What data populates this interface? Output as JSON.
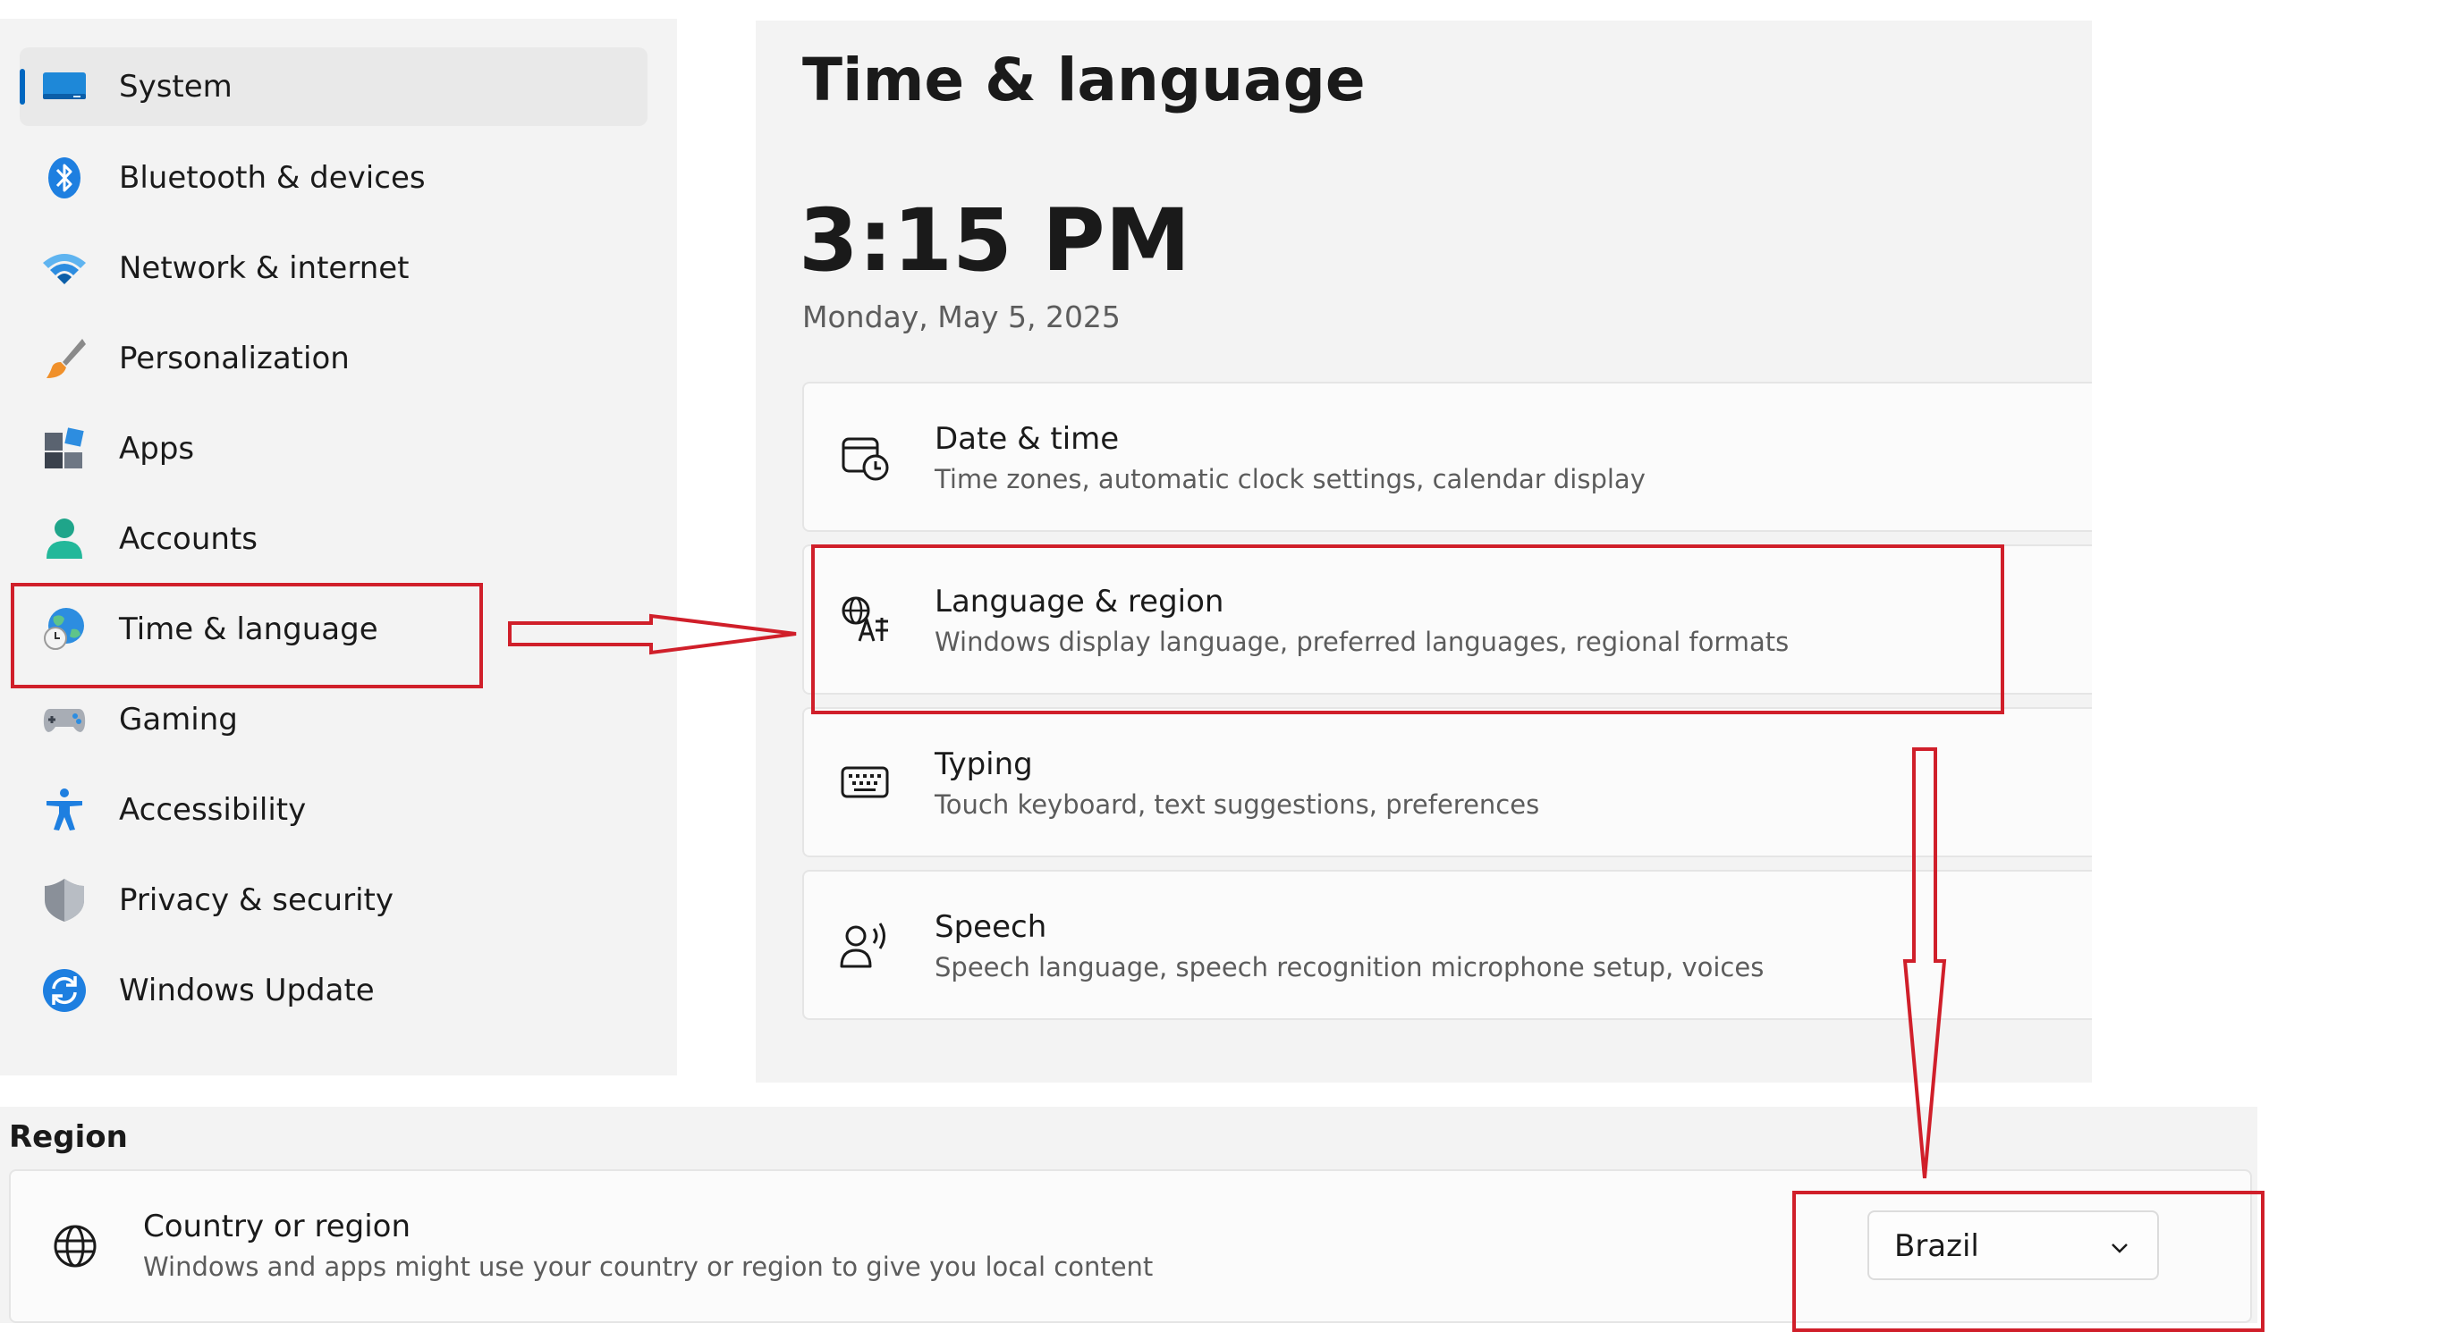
{
  "sidebar": {
    "items": [
      {
        "label": "System",
        "icon": "monitor-icon",
        "selected": true
      },
      {
        "label": "Bluetooth & devices",
        "icon": "bluetooth-icon"
      },
      {
        "label": "Network & internet",
        "icon": "wifi-icon"
      },
      {
        "label": "Personalization",
        "icon": "brush-icon"
      },
      {
        "label": "Apps",
        "icon": "apps-icon"
      },
      {
        "label": "Accounts",
        "icon": "person-icon"
      },
      {
        "label": "Time & language",
        "icon": "globe-clock-icon",
        "highlighted": true
      },
      {
        "label": "Gaming",
        "icon": "gamepad-icon"
      },
      {
        "label": "Accessibility",
        "icon": "accessibility-icon"
      },
      {
        "label": "Privacy & security",
        "icon": "shield-icon"
      },
      {
        "label": "Windows Update",
        "icon": "update-icon"
      }
    ]
  },
  "main": {
    "title": "Time & language",
    "time": "3:15 PM",
    "date": "Monday, May 5, 2025",
    "cards": [
      {
        "title": "Date & time",
        "description": "Time zones, automatic clock settings, calendar display",
        "icon": "calendar-clock-icon"
      },
      {
        "title": "Language & region",
        "description": "Windows display language, preferred languages, regional formats",
        "icon": "language-icon",
        "highlighted": true
      },
      {
        "title": "Typing",
        "description": "Touch keyboard, text suggestions, preferences",
        "icon": "keyboard-icon"
      },
      {
        "title": "Speech",
        "description": "Speech language, speech recognition microphone setup, voices",
        "icon": "speech-icon"
      }
    ]
  },
  "region": {
    "section_title": "Region",
    "setting": {
      "title": "Country or region",
      "description": "Windows and apps might use your country or region to give you local content",
      "icon": "globe-icon"
    },
    "dropdown": {
      "value": "Brazil",
      "icon": "chevron-down-icon"
    }
  },
  "colors": {
    "accent": "#0067c0",
    "annotation": "#d01f2a",
    "panel_background": "#f3f3f3",
    "card_background": "#fbfbfb"
  }
}
